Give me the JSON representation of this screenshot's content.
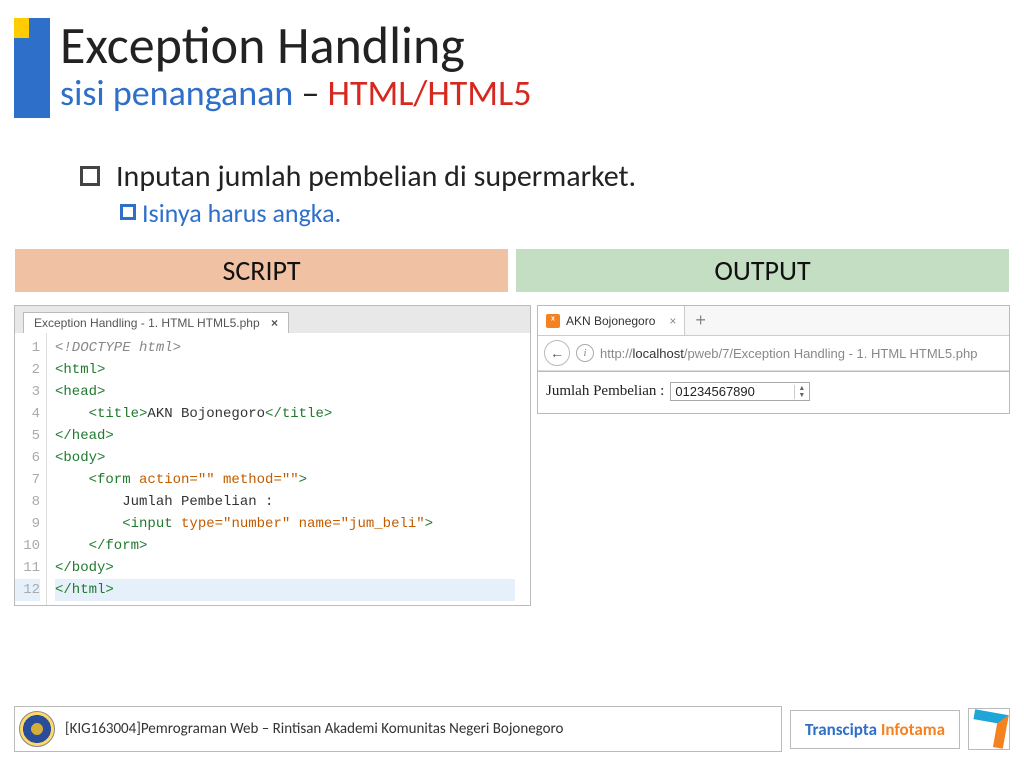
{
  "title": {
    "main": "Exception Handling",
    "sub_blue": "sisi penanganan ",
    "sub_dash": "– ",
    "sub_red": "HTML/HTML5"
  },
  "bullets": {
    "level1": "Inputan jumlah pembelian di supermarket.",
    "level2": "Isinya harus angka."
  },
  "columns": {
    "left": "SCRIPT",
    "right": "OUTPUT"
  },
  "editor": {
    "tab": "Exception Handling - 1. HTML HTML5.php",
    "lines": [
      "1",
      "2",
      "3",
      "4",
      "5",
      "6",
      "7",
      "8",
      "9",
      "10",
      "11",
      "12"
    ],
    "code": {
      "l1": "<!DOCTYPE html>",
      "l2": "<html>",
      "l3": "<head>",
      "l4_open": "    <title>",
      "l4_text": "AKN Bojonegoro",
      "l4_close": "</title>",
      "l5": "</head>",
      "l6": "<body>",
      "l7a": "    <form ",
      "l7b": "action=\"\" method=\"\"",
      "l7c": ">",
      "l8": "        Jumlah Pembelian :",
      "l9a": "        <input ",
      "l9b": "type=\"number\" name=\"jum_beli\"",
      "l9c": ">",
      "l10": "    </form>",
      "l11": "</body>",
      "l12": "</html>"
    }
  },
  "browser": {
    "tab_title": "AKN Bojonegoro",
    "plus": "+",
    "url_prefix": "http://",
    "url_host": "localhost",
    "url_path": "/pweb/7/Exception Handling - 1. HTML HTML5.php",
    "form_label": "Jumlah Pembelian :",
    "input_value": "01234567890"
  },
  "footer": {
    "course": "[KIG163004]Pemrograman Web – Rintisan Akademi Komunitas Negeri Bojonegoro",
    "brand1": "Transcipta ",
    "brand2": "Infotama"
  }
}
